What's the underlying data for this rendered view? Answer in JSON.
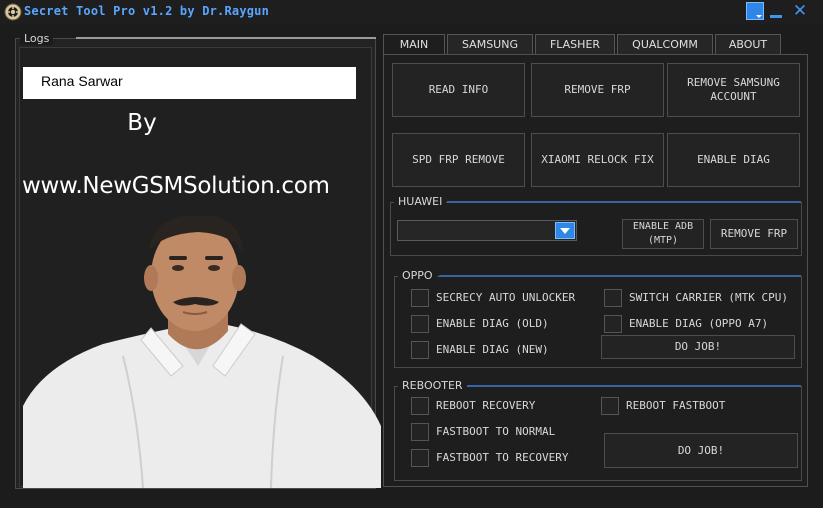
{
  "window": {
    "title": "Secret Tool Pro v1.2 by Dr.Raygun"
  },
  "logs": {
    "label": "Logs",
    "field_value": "Rana Sarwar",
    "by_text": "By",
    "website": "www.NewGSMSolution.com"
  },
  "tabs": [
    "MAIN",
    "SAMSUNG",
    "FLASHER",
    "QUALCOMM",
    "ABOUT"
  ],
  "main": {
    "read_info": "READ INFO",
    "remove_frp": "REMOVE FRP",
    "remove_samsung_account": "REMOVE SAMSUNG ACCOUNT",
    "spd_frp_remove": "SPD FRP REMOVE",
    "xiaomi_relock_fix": "XIAOMI RELOCK FIX",
    "enable_diag": "ENABLE DIAG"
  },
  "huawei": {
    "label": "HUAWEI",
    "combo_value": "",
    "enable_adb": "ENABLE ADB (MTP)",
    "remove_frp": "REMOVE FRP"
  },
  "oppo": {
    "label": "OPPO",
    "secrecy": "SECRECY AUTO UNLOCKER",
    "enable_diag_old": "ENABLE DIAG (OLD)",
    "enable_diag_new": "ENABLE DIAG (NEW)",
    "switch_carrier": "SWITCH CARRIER (MTK CPU)",
    "enable_diag_a7": "ENABLE DIAG (OPPO A7)",
    "do_job": "DO JOB!"
  },
  "rebooter": {
    "label": "REBOOTER",
    "reboot_recovery": "REBOOT RECOVERY",
    "fastboot_to_normal": "FASTBOOT TO NORMAL",
    "fastboot_to_recovery": "FASTBOOT TO RECOVERY",
    "reboot_fastboot": "REBOOT FASTBOOT",
    "do_job": "DO JOB!"
  },
  "colors": {
    "accent": "#2d86e8",
    "title_text": "#5aa6ff",
    "background": "#1c1c1c"
  },
  "icons": [
    "app-gear-icon",
    "box-icon",
    "minimize-icon",
    "close-icon",
    "chevron-down-icon"
  ]
}
